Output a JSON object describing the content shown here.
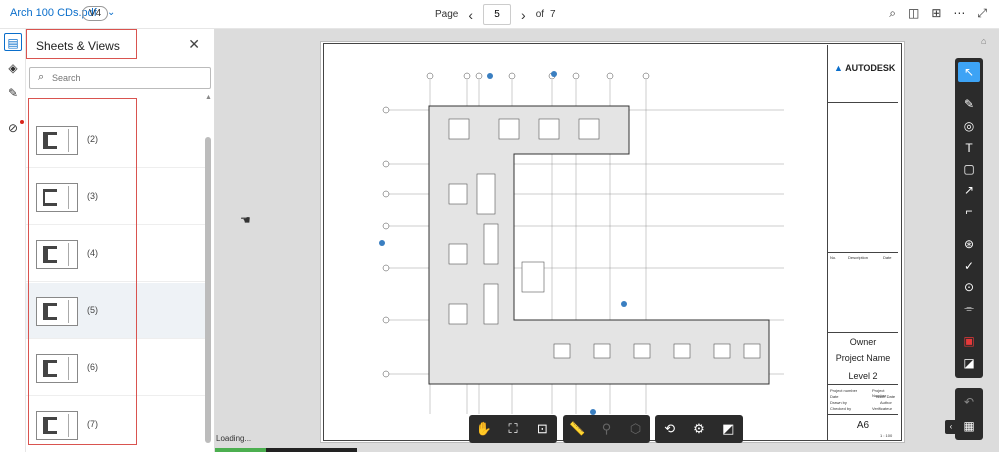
{
  "header": {
    "doc_title": "Arch 100 CDs.pdf",
    "version": "V4",
    "version_chevron": "⌄",
    "page_label": "Page",
    "current_page": "5",
    "of_label": "of",
    "total_pages": "7",
    "prev_icon": "‹",
    "next_icon": "›"
  },
  "top_icons": {
    "search": "⌕",
    "markup": "◫",
    "compare": "⊞",
    "more": "⋯",
    "expand": "⤢"
  },
  "panel": {
    "title": "Sheets & Views",
    "close_icon": "✕",
    "search_placeholder": "Search",
    "search_icon": "⌕",
    "items": [
      {
        "label": "(2)"
      },
      {
        "label": "(3)"
      },
      {
        "label": "(4)"
      },
      {
        "label": "(5)",
        "selected": true
      },
      {
        "label": "(6)"
      },
      {
        "label": "(7)"
      }
    ]
  },
  "sheet": {
    "brand": "AUTODESK",
    "owner": "Owner",
    "project_name": "Project Name",
    "level": "Level 2",
    "sheet_number": "A6",
    "col_headers": [
      "No.",
      "Description",
      "Date"
    ],
    "title_rows": [
      "Project number",
      "Date",
      "Drawn by",
      "Checked by"
    ],
    "title_values": [
      "Project Number",
      "Issue Date",
      "Author",
      "Verificateur"
    ],
    "scale": "1 : 100"
  },
  "status": {
    "loading_text": "Loading...",
    "progress": 0.36
  },
  "bottom_toolbar": {
    "pan": "✋",
    "fit": "⛶",
    "zoom_region": "⊡",
    "measure": "📏",
    "location": "⚲",
    "model": "⬡",
    "rotate": "⟲",
    "settings": "⚙",
    "fullscreen": "◩"
  },
  "right_tools": {
    "select": "↖",
    "pen": "✎",
    "shapes": "◎",
    "text": "T",
    "cloud": "▢",
    "callout": "↗",
    "polyline": "⌐",
    "stamp": "⊛",
    "check": "✓",
    "camera": "⊙",
    "measure": "⌯",
    "stroke_color": "▣",
    "fill_color": "◪",
    "undo": "↶",
    "palette": "▦"
  },
  "colors": {
    "accent": "#0a6ecb",
    "highlight_red": "#d9534f",
    "toolbar_bg": "#2b2b2b"
  }
}
